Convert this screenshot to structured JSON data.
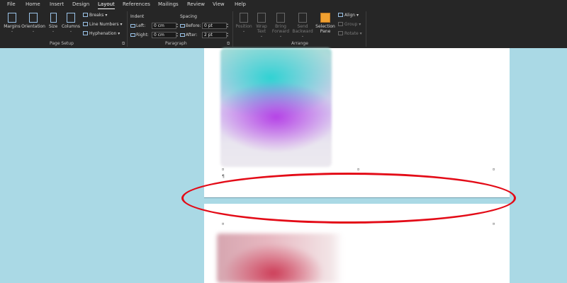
{
  "ribbon": {
    "tabs": [
      "File",
      "Home",
      "Insert",
      "Design",
      "Layout",
      "References",
      "Mailings",
      "Review",
      "View",
      "Help"
    ],
    "active_tab": "Layout",
    "page_setup": {
      "margins": "Margins",
      "orientation": "Orientation",
      "size": "Size",
      "columns": "Columns",
      "breaks": "Breaks",
      "line_numbers": "Line Numbers",
      "hyphenation": "Hyphenation",
      "group_label": "Page Setup"
    },
    "paragraph": {
      "indent_label": "Indent",
      "left_label": "Left:",
      "right_label": "Right:",
      "left_value": "0 cm",
      "right_value": "0 cm",
      "spacing_label": "Spacing",
      "before_label": "Before:",
      "after_label": "After:",
      "before_value": "0 pt",
      "after_value": "2 pt",
      "group_label": "Paragraph"
    },
    "arrange": {
      "position": "Position",
      "wrap_text": "Wrap Text",
      "bring_forward": "Bring Forward",
      "send_backward": "Send Backward",
      "selection_pane_1": "Selection",
      "selection_pane_2": "Pane",
      "align": "Align",
      "group": "Group",
      "rotate": "Rotate",
      "group_label": "Arrange"
    },
    "launcher_glyph": "⧉"
  },
  "document": {
    "pilcrow": "¶",
    "tab_marker": "¤"
  },
  "colors": {
    "ribbon_bg": "#262626",
    "workspace_bg": "#aad9e5",
    "annotation": "#e30b17"
  }
}
